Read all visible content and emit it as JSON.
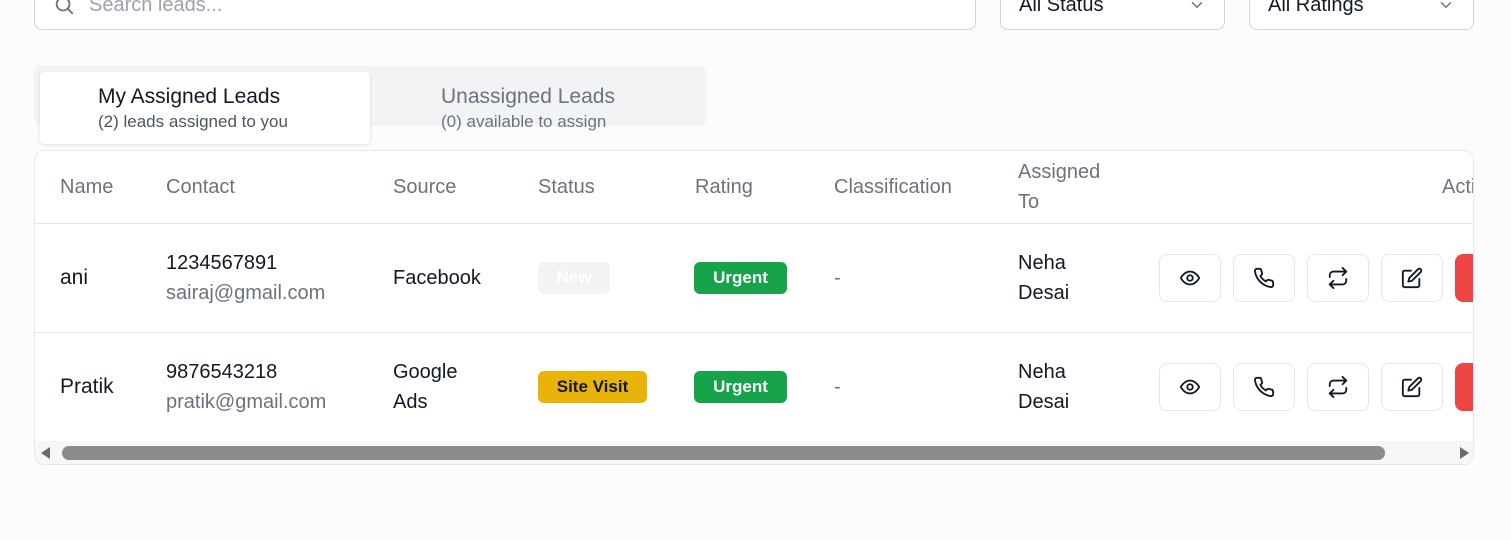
{
  "filters": {
    "search_placeholder": "Search leads...",
    "status_value": "All Status",
    "rating_value": "All Ratings"
  },
  "tabs": [
    {
      "title": "My Assigned Leads",
      "subtitle": "(2) leads assigned to you",
      "active": true
    },
    {
      "title": "Unassigned Leads",
      "subtitle": "(0) available to assign",
      "active": false
    }
  ],
  "table": {
    "headers": {
      "name": "Name",
      "contact": "Contact",
      "source": "Source",
      "status": "Status",
      "rating": "Rating",
      "classification": "Classification",
      "assigned_to_1": "Assigned",
      "assigned_to_2": "To",
      "actions": "Actions"
    },
    "rows": [
      {
        "name": "ani",
        "phone": "1234567891",
        "email": "sairaj@gmail.com",
        "source_1": "Facebook",
        "source_2": "",
        "status": "New",
        "rating": "Urgent",
        "classification": "-",
        "assigned_1": "Neha",
        "assigned_2": "Desai"
      },
      {
        "name": "Pratik",
        "phone": "9876543218",
        "email": "pratik@gmail.com",
        "source_1": "Google",
        "source_2": "Ads",
        "status": "Site Visit",
        "rating": "Urgent",
        "classification": "-",
        "assigned_1": "Neha",
        "assigned_2": "Desai"
      }
    ]
  },
  "action_icons": [
    "eye-icon",
    "phone-icon",
    "swap-icon",
    "edit-icon",
    "delete-icon"
  ],
  "colors": {
    "status_new": "#f1f3f5",
    "status_site_visit": "#eab308",
    "rating_urgent": "#16a34a",
    "delete": "#ef4444"
  }
}
